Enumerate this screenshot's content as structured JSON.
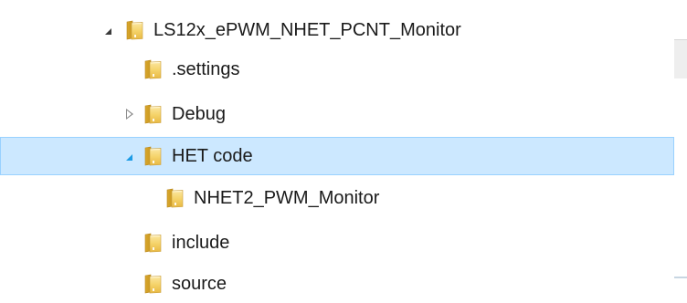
{
  "tree": {
    "items": [
      {
        "label": "LS12x_ePWM_NHET_PCNT_Monitor",
        "expander": "expanded",
        "selected": false,
        "icon": "folder-icon"
      },
      {
        "label": ".settings",
        "expander": "none",
        "selected": false,
        "icon": "folder-icon"
      },
      {
        "label": "Debug",
        "expander": "collapsed",
        "selected": false,
        "icon": "folder-icon"
      },
      {
        "label": "HET code",
        "expander": "expanded",
        "selected": true,
        "icon": "folder-icon"
      },
      {
        "label": "NHET2_PWM_Monitor",
        "expander": "none",
        "selected": false,
        "icon": "folder-icon"
      },
      {
        "label": "include",
        "expander": "none",
        "selected": false,
        "icon": "folder-icon"
      },
      {
        "label": "source",
        "expander": "none",
        "selected": false,
        "icon": "folder-icon"
      }
    ]
  },
  "colors": {
    "selection_background": "#cce8ff",
    "selection_border": "#99d1ff",
    "folder_yellow": "#f5d36a",
    "folder_dark": "#d9a82e"
  }
}
